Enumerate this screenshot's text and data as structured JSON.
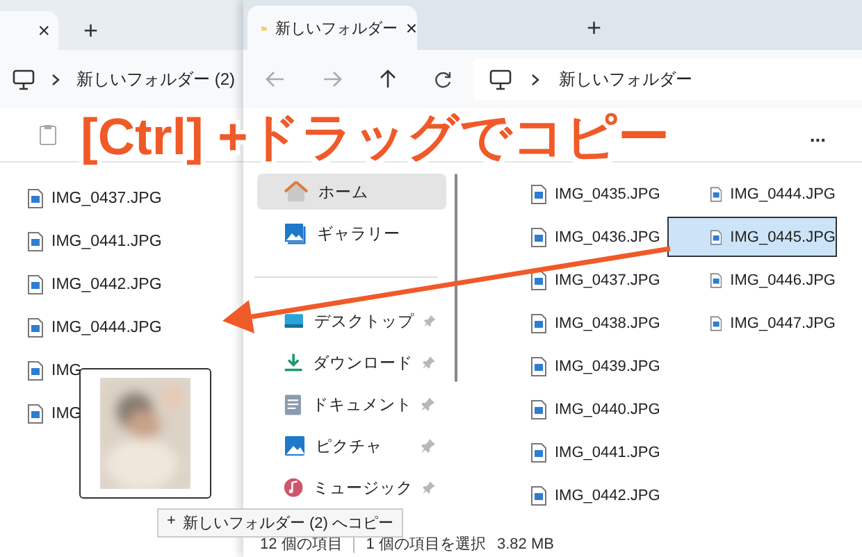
{
  "left_window": {
    "tab_close": "×",
    "new_tab": "+",
    "breadcrumb": "新しいフォルダー (2)",
    "files": [
      "IMG_0437.JPG",
      "IMG_0441.JPG",
      "IMG_0442.JPG",
      "IMG_0444.JPG",
      "IMG",
      "IMG"
    ]
  },
  "right_window": {
    "tab": {
      "title": "新しいフォルダー",
      "close": "×"
    },
    "new_tab": "+",
    "address": "新しいフォルダー",
    "more": "...",
    "sidebar": {
      "items": [
        {
          "label": "ホーム",
          "kind": "home",
          "selected": true,
          "pinned": false
        },
        {
          "label": "ギャラリー",
          "kind": "gallery",
          "selected": false,
          "pinned": false
        },
        {
          "label": "デスクトップ",
          "kind": "desktop",
          "selected": false,
          "pinned": true
        },
        {
          "label": "ダウンロード",
          "kind": "download",
          "selected": false,
          "pinned": true
        },
        {
          "label": "ドキュメント",
          "kind": "documents",
          "selected": false,
          "pinned": true
        },
        {
          "label": "ピクチャ",
          "kind": "pictures",
          "selected": false,
          "pinned": true
        },
        {
          "label": "ミュージック",
          "kind": "music",
          "selected": false,
          "pinned": true
        }
      ]
    },
    "files": [
      {
        "name": "IMG_0435.JPG",
        "selected": false
      },
      {
        "name": "IMG_0436.JPG",
        "selected": false
      },
      {
        "name": "IMG_0437.JPG",
        "selected": false
      },
      {
        "name": "IMG_0438.JPG",
        "selected": false
      },
      {
        "name": "IMG_0439.JPG",
        "selected": false
      },
      {
        "name": "IMG_0440.JPG",
        "selected": false
      },
      {
        "name": "IMG_0441.JPG",
        "selected": false
      },
      {
        "name": "IMG_0442.JPG",
        "selected": false
      },
      {
        "name": "IMG_0444.JPG",
        "selected": false
      },
      {
        "name": "IMG_0445.JPG",
        "selected": true
      },
      {
        "name": "IMG_0446.JPG",
        "selected": false
      },
      {
        "name": "IMG_0447.JPG",
        "selected": false
      }
    ],
    "status_bar": {
      "count": "12 個の項目",
      "selection": "1 個の項目を選択",
      "size": "3.82 MB"
    }
  },
  "drag": {
    "tooltip_icon": "+",
    "tooltip": "新しいフォルダー (2) へコピー"
  },
  "annotation": {
    "title": "[Ctrl] +ドラッグでコピー"
  }
}
